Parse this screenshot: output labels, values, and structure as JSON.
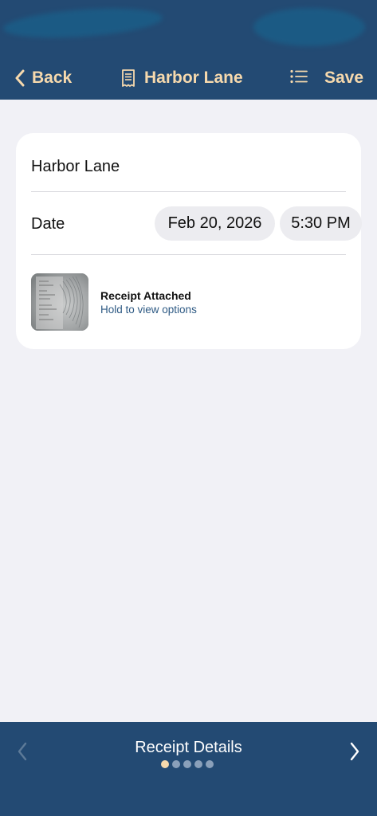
{
  "header": {
    "back_label": "Back",
    "title": "Harbor Lane",
    "save_label": "Save",
    "accent_color": "#f6d9ad",
    "bar_color": "#234a73",
    "icons": {
      "back": "chevron-left-icon",
      "title": "receipt-icon",
      "menu": "list-icon"
    }
  },
  "card": {
    "name_value": "Harbor Lane",
    "date_label": "Date",
    "date_value": "Feb 20, 2026",
    "time_value": "5:30 PM",
    "receipt": {
      "title": "Receipt Attached",
      "subtitle": "Hold to view options"
    }
  },
  "footer": {
    "title": "Receipt Details",
    "page_count": 5,
    "current_page": 1,
    "icons": {
      "prev": "chevron-left-icon",
      "next": "chevron-right-icon"
    }
  }
}
